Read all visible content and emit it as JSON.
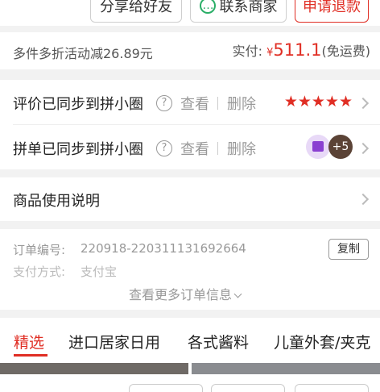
{
  "actions": {
    "share": "分享给好友",
    "contact": "联系商家",
    "refund": "申请退款"
  },
  "discount": {
    "label": "多件多折活动减26.89元",
    "paid_label": "实付:",
    "currency": "¥",
    "amount": "511.1",
    "note": "(免运费)"
  },
  "sync": {
    "review": {
      "title": "评价已同步到拼小圈",
      "view": "查看",
      "delete": "删除",
      "stars": "★★★★★",
      "rating": 5
    },
    "group": {
      "title": "拼单已同步到拼小圈",
      "view": "查看",
      "delete": "删除",
      "more": "+5"
    }
  },
  "manual": {
    "title": "商品使用说明"
  },
  "order": {
    "number_label": "订单编号:",
    "number": "220918-220311131692664",
    "copy": "复制",
    "pay_label": "支付方式:",
    "pay_value": "支付宝",
    "more": "查看更多订单信息"
  },
  "tabs": [
    "精选",
    "进口居家日用",
    "各式酱料",
    "儿童外套/夹克"
  ],
  "colors": {
    "accent": "#e02e24",
    "wechat": "#2aae67"
  }
}
